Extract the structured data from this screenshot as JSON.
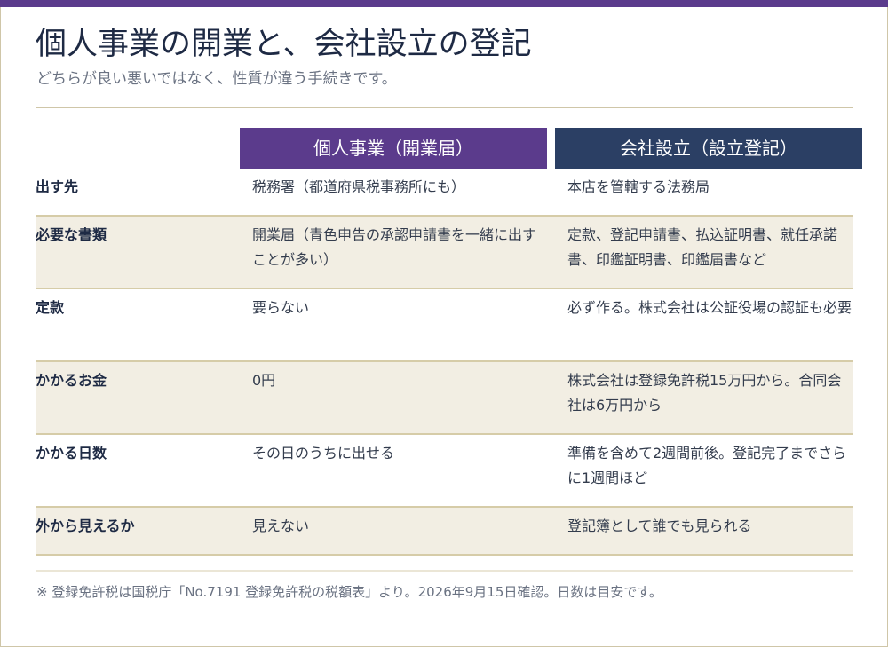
{
  "title": "個人事業の開業と、会社設立の登記",
  "subtitle": "どちらが良い悪いではなく、性質が違う手続きです。",
  "columns": {
    "a": "個人事業（開業届）",
    "b": "会社設立（設立登記）"
  },
  "rows": [
    {
      "label": "出す先",
      "a": "税務署（都道府県税事務所にも）",
      "b": "本店を管轄する法務局"
    },
    {
      "label": "必要な書類",
      "a": "開業届（青色申告の承認申請書を一緒に出すことが多い）",
      "b": "定款、登記申請書、払込証明書、就任承諾書、印鑑証明書、印鑑届書など"
    },
    {
      "label": "定款",
      "a": "要らない",
      "b": "必ず作る。株式会社は公証役場の認証も必要"
    },
    {
      "label": "かかるお金",
      "a": "0円",
      "b": "株式会社は登録免許税15万円から。合同会社は6万円から"
    },
    {
      "label": "かかる日数",
      "a": "その日のうちに出せる",
      "b": "準備を含めて2週間前後。登記完了までさらに1週間ほど"
    },
    {
      "label": "外から見えるか",
      "a": "見えない",
      "b": "登記簿として誰でも見られる"
    }
  ],
  "note": "※ 登録免許税は国税庁「No.7191 登録免許税の税額表」より。2026年9月15日確認。日数は目安です。",
  "colors": {
    "accent_purple": "#5b3b8c",
    "accent_navy": "#2b3f64",
    "row_shade": "#f2eee3",
    "rule": "#cfc6a8"
  }
}
